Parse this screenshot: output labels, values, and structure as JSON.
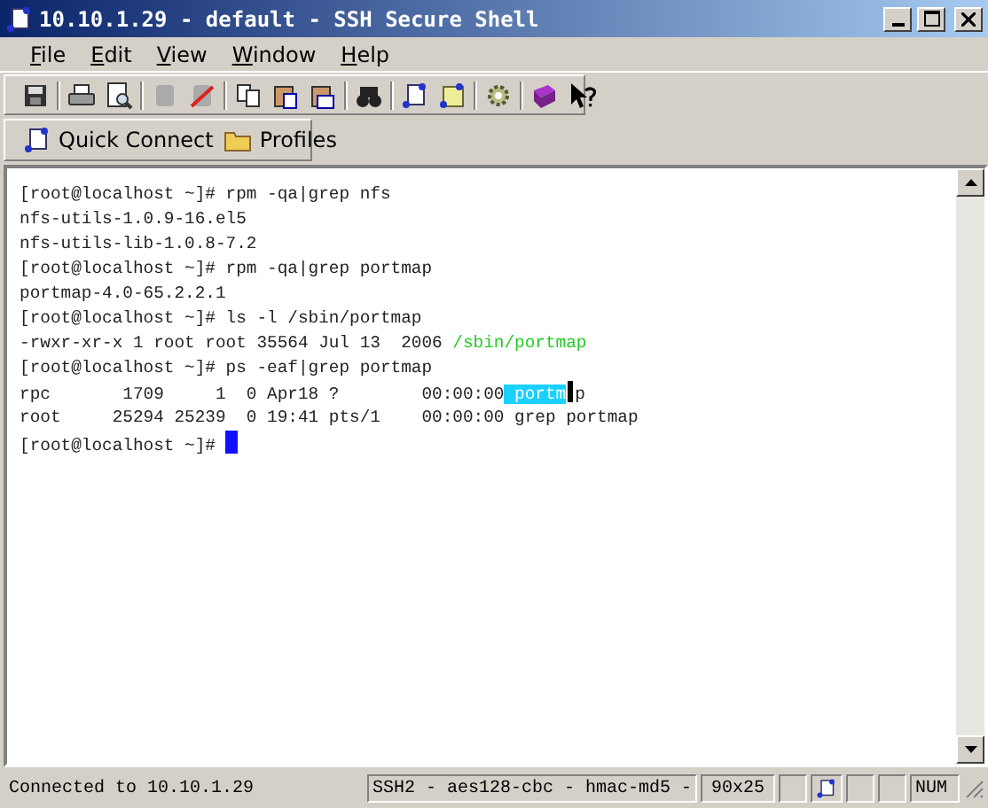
{
  "window": {
    "title": "10.10.1.29 - default - SSH Secure Shell"
  },
  "menu": [
    "File",
    "Edit",
    "View",
    "Window",
    "Help"
  ],
  "quick_bar": [
    {
      "label": "Quick Connect",
      "kind": "connect"
    },
    {
      "label": "Profiles",
      "kind": "folder"
    }
  ],
  "terminal": {
    "lines": [
      {
        "segments": [
          {
            "kind": "plain",
            "text": "[root@localhost ~]# rpm -qa|grep nfs"
          }
        ]
      },
      {
        "segments": [
          {
            "kind": "plain",
            "text": "nfs-utils-1.0.9-16.el5"
          }
        ]
      },
      {
        "segments": [
          {
            "kind": "plain",
            "text": "nfs-utils-lib-1.0.8-7.2"
          }
        ]
      },
      {
        "segments": [
          {
            "kind": "plain",
            "text": "[root@localhost ~]# rpm -qa|grep portmap"
          }
        ]
      },
      {
        "segments": [
          {
            "kind": "plain",
            "text": "portmap-4.0-65.2.2.1"
          }
        ]
      },
      {
        "segments": [
          {
            "kind": "plain",
            "text": "[root@localhost ~]# ls -l /sbin/portmap"
          }
        ]
      },
      {
        "segments": [
          {
            "kind": "plain",
            "text": "-rwxr-xr-x 1 root root 35564 Jul 13  2006 "
          },
          {
            "kind": "executable",
            "text": "/sbin/portmap"
          }
        ]
      },
      {
        "segments": [
          {
            "kind": "plain",
            "text": "[root@localhost ~]# ps -eaf|grep portmap"
          }
        ]
      },
      {
        "segments": [
          {
            "kind": "plain",
            "text": "rpc       1709     1  0 Apr18 ?        00:00:00"
          },
          {
            "kind": "selected",
            "text": " portm"
          },
          {
            "kind": "pointer"
          },
          {
            "kind": "plain",
            "text": "p"
          }
        ]
      },
      {
        "segments": [
          {
            "kind": "plain",
            "text": "root     25294 25239  0 19:41 pts/1    00:00:00 grep portmap"
          }
        ]
      },
      {
        "segments": [
          {
            "kind": "plain",
            "text": "[root@localhost ~]# "
          },
          {
            "kind": "cursor"
          }
        ]
      }
    ]
  },
  "status_bar": {
    "message": "Connected to 10.10.1.29",
    "cipher": "SSH2 - aes128-cbc - hmac-md5 -",
    "size": "90x25",
    "numlock": "NUM"
  }
}
